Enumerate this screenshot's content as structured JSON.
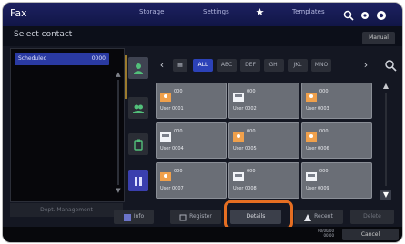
{
  "header": {
    "title": "Fax",
    "nav": [
      "Storage",
      "Settings",
      "Templates"
    ],
    "icons": [
      "star-icon",
      "search-icon",
      "gear-icon",
      "help-icon"
    ]
  },
  "subheader": {
    "label": "Select contact",
    "button_label": "Manual"
  },
  "left_panel": {
    "selected_item": {
      "name": "Scheduled",
      "count": "0000"
    },
    "footer_label": "Dept. Management"
  },
  "vertical_tabs": [
    "contact-person-icon",
    "group-icon",
    "clipboard-icon",
    "tile-view-icon"
  ],
  "index_tabs": [
    "ALL",
    "ABC",
    "DEF",
    "GHI",
    "JKL",
    "MNO"
  ],
  "contacts": [
    {
      "name": "000",
      "sub": "User 0001",
      "type": "group"
    },
    {
      "name": "000",
      "sub": "User 0002",
      "type": "fax"
    },
    {
      "name": "000",
      "sub": "User 0003",
      "type": "group"
    },
    {
      "name": "000",
      "sub": "User 0004",
      "type": "fax"
    },
    {
      "name": "000",
      "sub": "User 0005",
      "type": "group"
    },
    {
      "name": "000",
      "sub": "User 0006",
      "type": "group"
    },
    {
      "name": "000",
      "sub": "User 0007",
      "type": "group"
    },
    {
      "name": "000",
      "sub": "User 0008",
      "type": "fax"
    },
    {
      "name": "000",
      "sub": "User 0009",
      "type": "fax"
    }
  ],
  "toolbar": {
    "info_label": "Info",
    "register_label": "Register",
    "details_label": "Details",
    "recent_label": "Recent",
    "delete_label": "Delete",
    "cancel_label": "Cancel"
  },
  "timestamp": {
    "date": "00/00/00",
    "time": "00:00"
  },
  "colors": {
    "accent": "#2c42b8",
    "highlight": "#e56e22",
    "header": "#1d2160"
  }
}
